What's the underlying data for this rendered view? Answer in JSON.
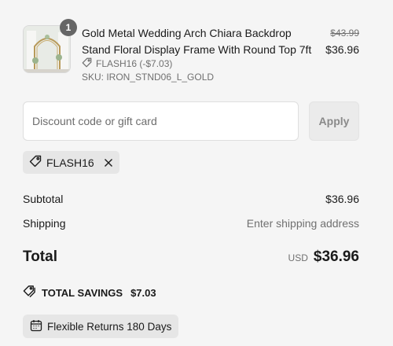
{
  "item": {
    "quantity": "1",
    "title": "Gold Metal Wedding Arch Chiara Backdrop Stand Floral Display Frame With Round Top 7ft",
    "original_price": "$43.99",
    "price": "$36.96",
    "discount_text": "FLASH16 (-$7.03)",
    "sku": "SKU: IRON_STND06_L_GOLD",
    "discount_icon": "tag-icon"
  },
  "discount": {
    "placeholder": "Discount code or gift card",
    "apply_label": "Apply",
    "applied_code": "FLASH16",
    "remove_icon": "close-icon"
  },
  "summary": {
    "subtotal_label": "Subtotal",
    "subtotal_value": "$36.96",
    "shipping_label": "Shipping",
    "shipping_value": "Enter shipping address",
    "total_label": "Total",
    "currency": "USD",
    "total_value": "$36.96"
  },
  "savings": {
    "label": "TOTAL SAVINGS",
    "amount": "$7.03",
    "icon": "tags-icon"
  },
  "returns": {
    "label": "Flexible Returns 180 Days",
    "icon": "calendar-icon"
  },
  "colors": {
    "background": "#f5f5f5",
    "badge": "#666666",
    "chip": "#e6e6e6",
    "muted_text": "#707070"
  }
}
